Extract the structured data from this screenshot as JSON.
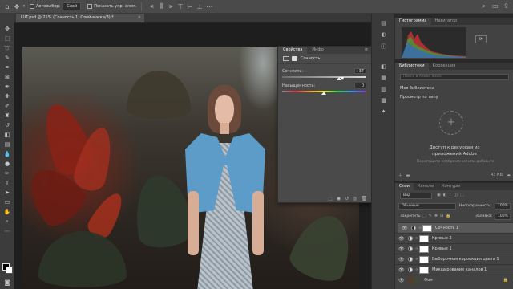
{
  "app": {
    "doc_tab": "LUT.psd @ 25% (Сочность 1, Слой-маска/8) *"
  },
  "options_bar": {
    "autoselect_label": "Автовыбор:",
    "autoselect_value": "Слой",
    "show_transform_label": "Показать упр. элем."
  },
  "properties": {
    "tab_active": "Свойства",
    "tab_inactive": "Инфо",
    "adjustment_name": "Сочность",
    "vibrance_label": "Сочность:",
    "vibrance_value": "+37",
    "saturation_label": "Насыщенность:",
    "saturation_value": "0",
    "vibrance_fraction": 0.68,
    "saturation_fraction": 0.5
  },
  "histogram": {
    "tab_active": "Гистограмма",
    "tab_inactive": "Навигатор"
  },
  "libraries": {
    "tab_active": "Библиотеки",
    "tab_inactive": "Коррекция",
    "search_placeholder": "Поиск в Adobe Stock",
    "my_library": "Моя библиотека",
    "view_by_type": "Просмотр по типу",
    "access_title": "Доступ к ресурсам из приложений Adobe",
    "access_hint": "Перетащите изображения или добавьте",
    "size_label": "43 КБ"
  },
  "layers": {
    "tab_active": "Слои",
    "tab_channels": "Каналы",
    "tab_paths": "Контуры",
    "filter_label": "Вид",
    "blend_mode": "Обычные",
    "opacity_label": "Непрозрачность:",
    "opacity_value": "100%",
    "lock_label": "Закрепить:",
    "fill_label": "Заливка:",
    "fill_value": "100%",
    "items": [
      {
        "name": "Сочность 1",
        "selected": true
      },
      {
        "name": "Кривые 2",
        "selected": false
      },
      {
        "name": "Кривые 1",
        "selected": false
      },
      {
        "name": "Выборочная коррекция цвета 1",
        "selected": false
      },
      {
        "name": "Микширование каналов 1",
        "selected": false
      },
      {
        "name": "Фон",
        "selected": false
      }
    ]
  },
  "colors": {
    "accent": "#4a90d9",
    "ui_dark": "#282828",
    "panel": "#424242"
  }
}
